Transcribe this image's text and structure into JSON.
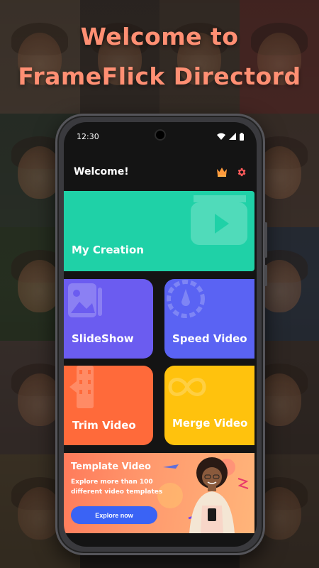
{
  "promo": {
    "headline_line1": "Welcome to",
    "headline_line2": "FrameFlick Directord"
  },
  "status_bar": {
    "time": "12:30",
    "icons": [
      "wifi-icon",
      "signal-icon",
      "battery-icon"
    ]
  },
  "header": {
    "title": "Welcome!",
    "icons": [
      "crown-icon",
      "gear-icon"
    ]
  },
  "cards": {
    "my_creation": "My Creation",
    "slideshow": "SlideShow",
    "speed_video": "Speed Video",
    "trim_video": "Trim Video",
    "merge_video": "Merge Video"
  },
  "template_banner": {
    "title": "Template Video",
    "subtitle": "Explore more than 100 different video templates",
    "button": "Explore now"
  },
  "colors": {
    "headline": "#ff8f73",
    "my_creation": "#1fd1a7",
    "slideshow": "#6b5cf0",
    "speed_video": "#5a63f3",
    "trim_video": "#ff6a3a",
    "merge_video": "#ffc20d",
    "explore_button": "#3a63f5",
    "screen_bg": "#141414"
  }
}
